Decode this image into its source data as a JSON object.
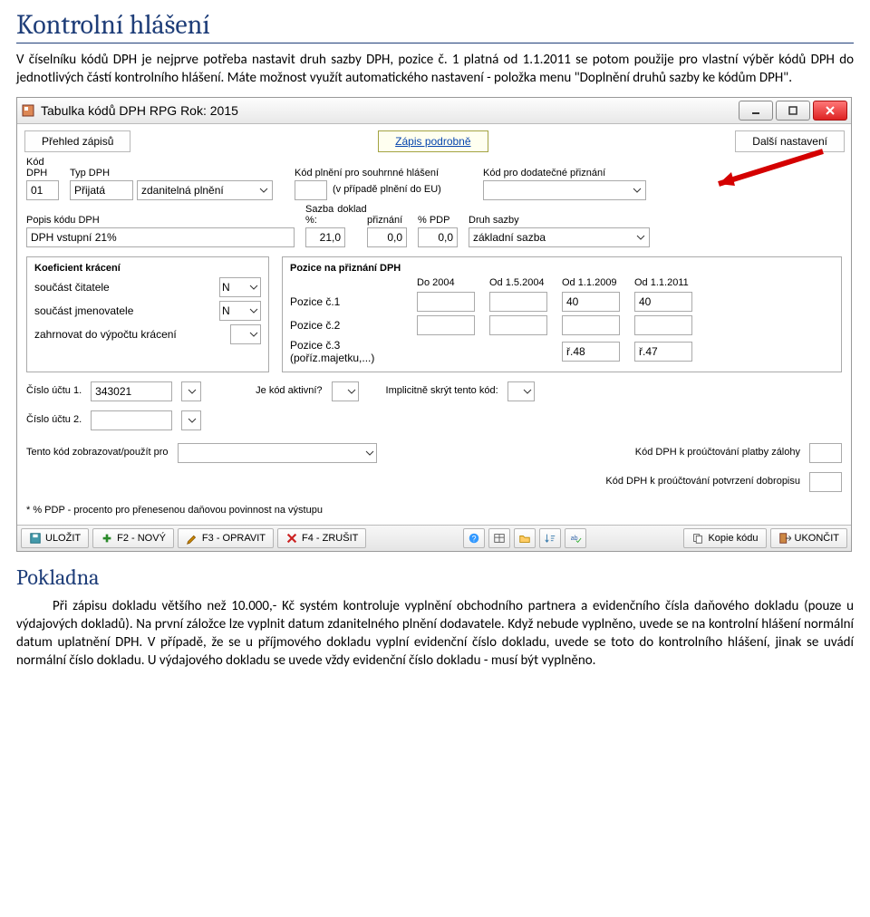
{
  "doc": {
    "h1": "Kontrolní hlášení",
    "p1": "V číselníku kódů DPH je nejprve potřeba nastavit druh sazby DPH, pozice č. 1 platná od 1.1.2011 se potom použije pro vlastní výběr kódů DPH do jednotlivých částí kontrolního hlášení. Máte možnost využít automatického nastavení - položka menu \"Doplnění druhů sazby ke kódům DPH\".",
    "h2": "Pokladna",
    "p2": "Při zápisu dokladu většího než 10.000,- Kč systém kontroluje vyplnění obchodního partnera a evidenčního čísla daňového dokladu (pouze u výdajových dokladů). Na první záložce lze vyplnit datum zdanitelného plnění dodavatele. Když nebude vyplněno, uvede se na kontrolní hlášení normální datum uplatnění DPH. V případě, že se u příjmového dokladu vyplní evidenční číslo dokladu, uvede se toto do kontrolního hlášení, jinak se uvádí normální číslo dokladu. U výdajového dokladu se uvede vždy evidenční číslo dokladu - musí být vyplněno."
  },
  "window": {
    "title": "Tabulka kódů DPH  RPG  Rok: 2015",
    "tabs": {
      "t1": "Přehled zápisů",
      "t2": "Zápis podrobně",
      "t3": "Další nastavení"
    },
    "fields": {
      "kod_dph_label": "Kód DPH",
      "kod_dph": "01",
      "typ_dph_label": "Typ DPH",
      "typ_dph": "Přijatá",
      "typ_dph2": "zdanitelná plnění",
      "kod_plneni_label": "Kód plnění pro souhrnné hlášení",
      "kod_plneni_sub": "(v případě plnění do EU)",
      "kod_dodatecne_label": "Kód pro dodatečné přiznání",
      "popis_label": "Popis kódu DPH",
      "popis": "DPH vstupní 21%",
      "sazba_label": "Sazba %:",
      "doklad_label": "doklad",
      "doklad": "21,0",
      "priznani_label": "přiznání",
      "priznani": "0,0",
      "pdp_pct_label": "% PDP",
      "pdp_pct": "0,0",
      "druh_sazby_label": "Druh sazby",
      "druh_sazby": "základní sazba"
    },
    "koef": {
      "title": "Koeficient krácení",
      "row1": "součást čitatele",
      "row1v": "N",
      "row2": "součást jmenovatele",
      "row2v": "N",
      "row3": "zahrnovat do výpočtu krácení"
    },
    "pos": {
      "title": "Pozice na přiznání DPH",
      "h1": "Do 2004",
      "h2": "Od 1.5.2004",
      "h3": "Od 1.1.2009",
      "h4": "Od 1.1.2011",
      "r1": "Pozice č.1",
      "r1v3": "40",
      "r1v4": "40",
      "r2": "Pozice č.2",
      "r3": "Pozice č.3 (poříz.majetku,...)",
      "r3v3": "ř.48",
      "r3v4": "ř.47"
    },
    "mid": {
      "ucet1_label": "Číslo účtu 1.",
      "ucet1": "343021",
      "ucet2_label": "Číslo účtu 2.",
      "aktivni_label": "Je kód aktivní?",
      "skryt_label": "Implicitně skrýt tento kód:",
      "zobraz_label": "Tento kód zobrazovat/použít pro",
      "kod_zaloha_label": "Kód DPH k proúčtování platby zálohy",
      "kod_dobropis_label": "Kód DPH k proúčtování potvrzení dobropisu"
    },
    "footnote": "* % PDP - procento pro přenesenou daňovou povinnost na výstupu",
    "toolbar": {
      "ulozit": "ULOŽIT",
      "novy": "F2 - NOVÝ",
      "opravit": "F3 - OPRAVIT",
      "zrusit": "F4 - ZRUŠIT",
      "kopie": "Kopie kódu",
      "ukoncit": "UKONČIT"
    }
  }
}
